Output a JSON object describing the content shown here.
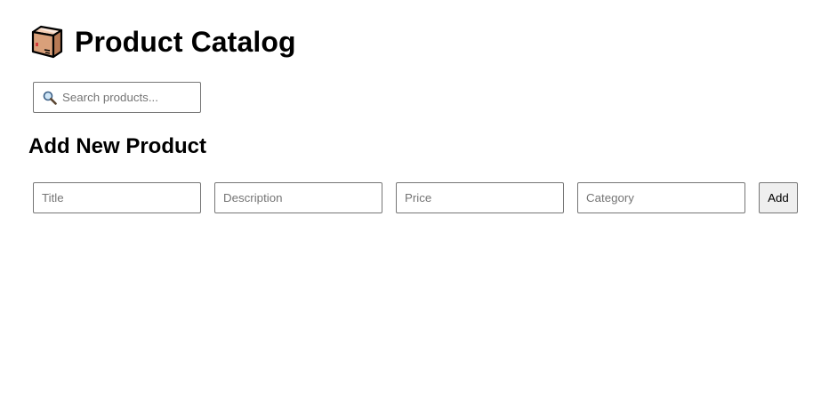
{
  "header": {
    "icon": "package-box-icon",
    "title": "Product Catalog"
  },
  "search": {
    "icon": "magnifier-icon",
    "placeholder": "Search products...",
    "value": ""
  },
  "add_product": {
    "heading": "Add New Product",
    "fields": {
      "title_placeholder": "Title",
      "description_placeholder": "Description",
      "price_placeholder": "Price",
      "category_placeholder": "Category"
    },
    "submit_label": "Add"
  },
  "colors": {
    "text": "#000000",
    "input_border": "#767676",
    "placeholder": "#757575",
    "button_bg": "#efefef",
    "box_brown": "#d9a07a"
  }
}
